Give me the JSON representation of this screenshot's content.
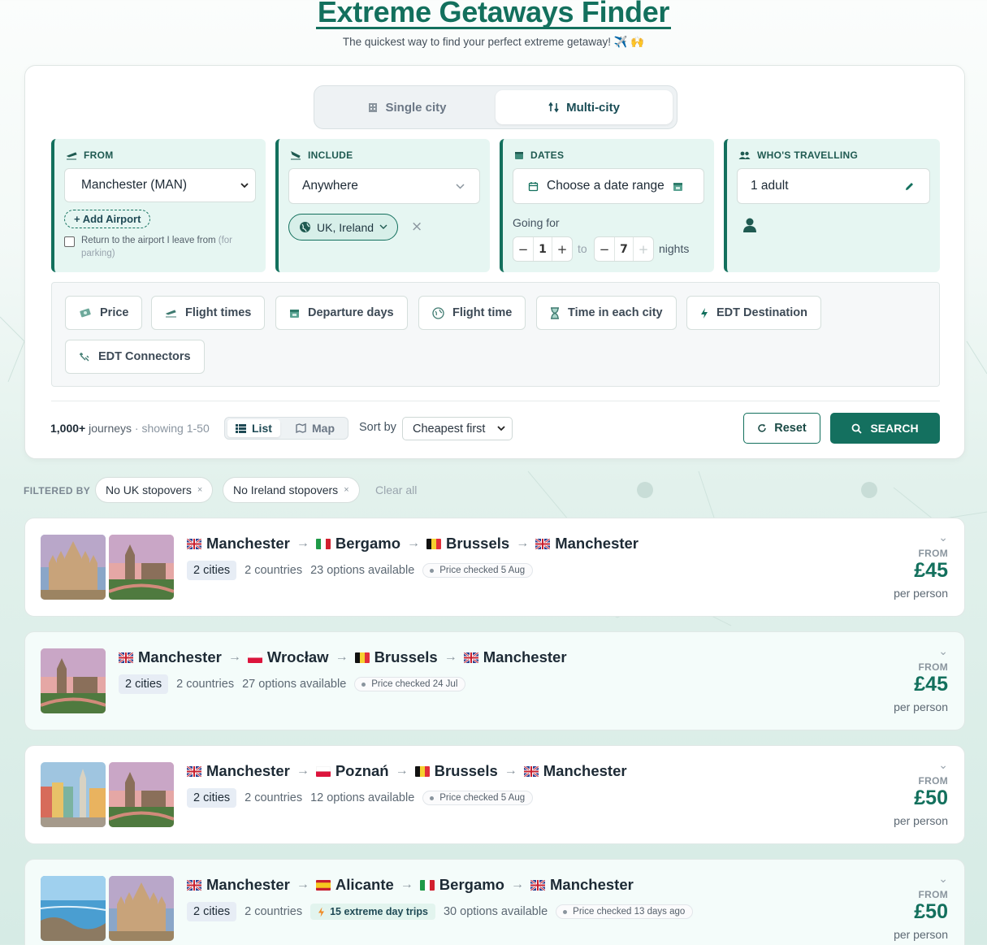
{
  "app": {
    "title": "Extreme Getaways Finder",
    "subtitle": "The quickest way to find your perfect extreme getaway! ✈️ 🙌"
  },
  "mode_toggle": {
    "single": "Single city",
    "multi": "Multi-city",
    "selected": "multi"
  },
  "from": {
    "label": "FROM",
    "value": "Manchester (MAN)",
    "add_airport": "+ Add Airport",
    "return_text": "Return to the airport I leave from",
    "return_hint": "(for parking)"
  },
  "include": {
    "label": "INCLUDE",
    "value": "Anywhere",
    "chip": "UK, Ireland"
  },
  "dates": {
    "label": "DATES",
    "value": "Choose a date range",
    "going_for": "Going for",
    "min_nights": "1",
    "max_nights": "7",
    "to": "to",
    "nights": "nights"
  },
  "travellers": {
    "label": "WHO'S TRAVELLING",
    "value": "1 adult"
  },
  "filter_buttons": [
    "Price",
    "Flight times",
    "Departure days",
    "Flight time",
    "Time in each city",
    "EDT Destination",
    "EDT Connectors"
  ],
  "results_bar": {
    "count": "1,000+",
    "journeys": "journeys",
    "showing": "· showing 1-50",
    "list": "List",
    "map": "Map",
    "sort_label": "Sort by",
    "sort_value": "Cheapest first",
    "reset": "Reset",
    "search": "SEARCH"
  },
  "filtered_by": {
    "label": "FILTERED BY",
    "chips": [
      "No UK stopovers",
      "No Ireland stopovers"
    ],
    "clear": "Clear all"
  },
  "results": [
    {
      "route": [
        "Manchester",
        "Bergamo",
        "Brussels",
        "Manchester"
      ],
      "cities": "2 cities",
      "countries": "2 countries",
      "options": "23 options available",
      "checked": "Price checked 5 Aug",
      "extreme": "",
      "from": "FROM",
      "price": "£45",
      "per": "per person"
    },
    {
      "route": [
        "Manchester",
        "Wrocław",
        "Brussels",
        "Manchester"
      ],
      "cities": "2 cities",
      "countries": "2 countries",
      "options": "27 options available",
      "checked": "Price checked 24 Jul",
      "extreme": "",
      "from": "FROM",
      "price": "£45",
      "per": "per person"
    },
    {
      "route": [
        "Manchester",
        "Poznań",
        "Brussels",
        "Manchester"
      ],
      "cities": "2 cities",
      "countries": "2 countries",
      "options": "12 options available",
      "checked": "Price checked 5 Aug",
      "extreme": "",
      "from": "FROM",
      "price": "£50",
      "per": "per person"
    },
    {
      "route": [
        "Manchester",
        "Alicante",
        "Bergamo",
        "Manchester"
      ],
      "cities": "2 cities",
      "countries": "2 countries",
      "options": "30 options available",
      "checked": "Price checked 13 days ago",
      "extreme": "15 extreme day trips",
      "from": "FROM",
      "price": "£50",
      "per": "per person"
    }
  ],
  "colors": {
    "brand": "#13705d",
    "panel": "#e6f6f2"
  }
}
